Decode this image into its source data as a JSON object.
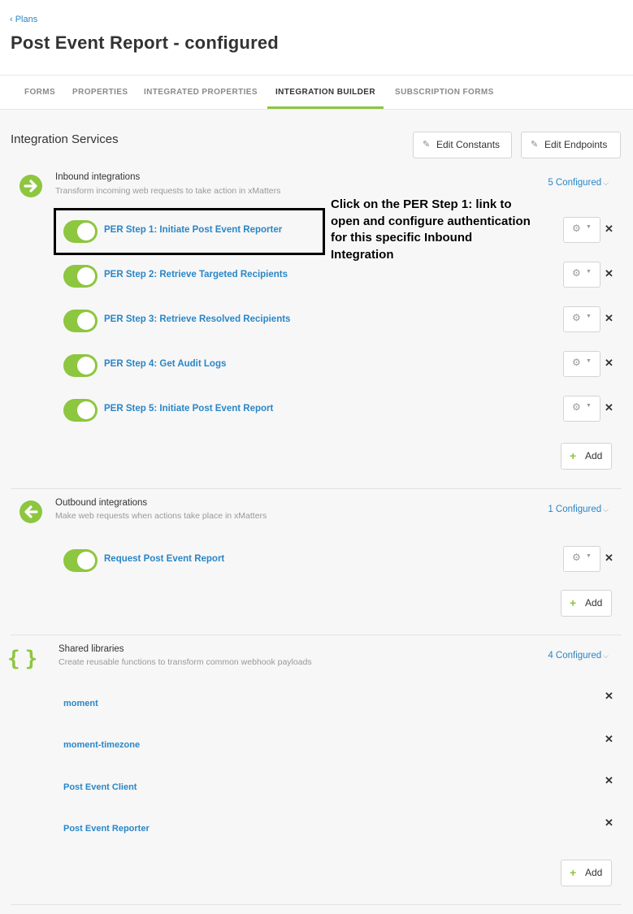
{
  "header": {
    "back_link": "‹ Plans",
    "title": "Post Event Report - configured"
  },
  "tabs": [
    {
      "label": "FORMS"
    },
    {
      "label": "PROPERTIES"
    },
    {
      "label": "INTEGRATED PROPERTIES"
    },
    {
      "label": "INTEGRATION BUILDER",
      "active": true
    },
    {
      "label": "SUBSCRIPTION FORMS"
    }
  ],
  "services": {
    "title": "Integration Services",
    "edit_constants": "Edit Constants",
    "edit_endpoints": "Edit Endpoints"
  },
  "inbound": {
    "title": "Inbound integrations",
    "subtitle": "Transform incoming web requests to take action in xMatters",
    "configured": "5 Configured",
    "items": [
      {
        "label": "PER Step 1: Initiate Post Event Reporter",
        "enabled": true
      },
      {
        "label": "PER Step 2: Retrieve Targeted Recipients",
        "enabled": true
      },
      {
        "label": "PER Step 3: Retrieve Resolved Recipients",
        "enabled": true
      },
      {
        "label": "PER Step 4: Get Audit Logs",
        "enabled": true
      },
      {
        "label": "PER Step 5: Initiate Post Event Report",
        "enabled": true
      }
    ],
    "add_label": "Add"
  },
  "outbound": {
    "title": "Outbound integrations",
    "subtitle": "Make web requests when actions take place in xMatters",
    "configured": "1 Configured",
    "items": [
      {
        "label": "Request Post Event Report",
        "enabled": true
      }
    ],
    "add_label": "Add"
  },
  "libraries": {
    "title": "Shared libraries",
    "subtitle": "Create reusable functions to transform common webhook payloads",
    "configured": "4 Configured",
    "items": [
      {
        "label": "moment"
      },
      {
        "label": "moment-timezone"
      },
      {
        "label": "Post Event Client"
      },
      {
        "label": "Post Event Reporter"
      }
    ],
    "add_label": "Add"
  },
  "annotation": {
    "callout": "Click on the PER Step 1: link to open and configure authentication for this specific Inbound Integration"
  },
  "icons": {
    "accent_color": "#8dc63f",
    "link_color": "#2a86c6",
    "inbound": "arrow-right-circle-icon",
    "outbound": "arrow-left-circle-icon",
    "libraries": "curly-braces-icon",
    "gear": "gear-icon",
    "delete": "close-icon",
    "edit": "pencil-icon"
  }
}
